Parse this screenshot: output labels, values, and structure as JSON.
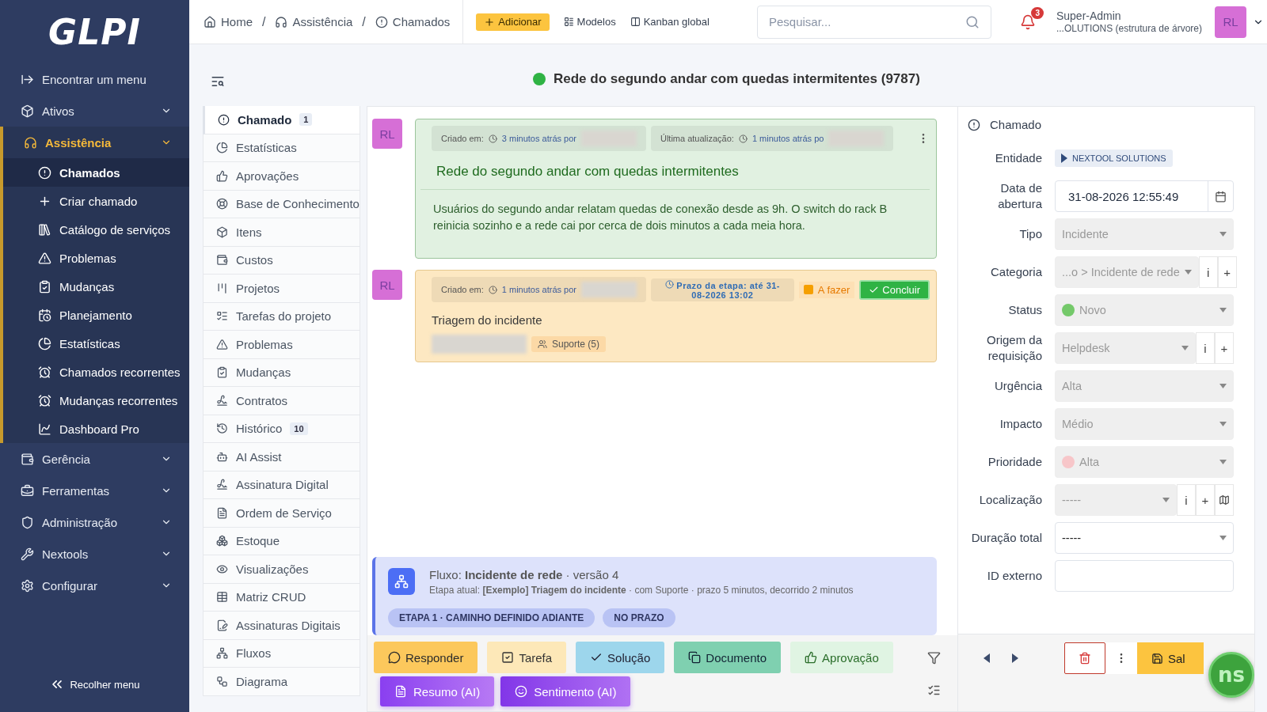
{
  "sidebar": {
    "logo": "GLPI",
    "find_menu": "Encontrar um menu",
    "items": [
      {
        "label": "Ativos",
        "expanded": false,
        "selected": false
      },
      {
        "label": "Assistência",
        "expanded": true,
        "selected": true,
        "children": [
          {
            "label": "Chamados",
            "selected": true
          },
          {
            "label": "Criar chamado",
            "selected": false
          },
          {
            "label": "Catálogo de serviços",
            "selected": false
          },
          {
            "label": "Problemas",
            "selected": false
          },
          {
            "label": "Mudanças",
            "selected": false
          },
          {
            "label": "Planejamento",
            "selected": false
          },
          {
            "label": "Estatísticas",
            "selected": false
          },
          {
            "label": "Chamados recorrentes",
            "selected": false
          },
          {
            "label": "Mudanças recorrentes",
            "selected": false
          },
          {
            "label": "Dashboard Pro",
            "selected": false
          }
        ]
      },
      {
        "label": "Gerência",
        "expanded": false,
        "selected": false
      },
      {
        "label": "Ferramentas",
        "expanded": false,
        "selected": false
      },
      {
        "label": "Administração",
        "expanded": false,
        "selected": false
      },
      {
        "label": "Nextools",
        "expanded": false,
        "selected": false
      },
      {
        "label": "Configurar",
        "expanded": false,
        "selected": false
      }
    ],
    "collapse": "Recolher menu"
  },
  "breadcrumb": {
    "items": [
      "Home",
      "Assistência",
      "Chamados"
    ],
    "separator": "/"
  },
  "toolbar": {
    "add": "Adicionar",
    "templates": "Modelos",
    "kanban": "Kanban global"
  },
  "search": {
    "placeholder": "Pesquisar..."
  },
  "notifications": {
    "count": "3"
  },
  "user": {
    "name": "Super-Admin",
    "entity": "...OLUTIONS (estrutura de árvore)",
    "initials": "RL"
  },
  "ticket_title": "Rede do segundo andar com quedas intermitentes (9787)",
  "tabs": [
    {
      "label": "Chamado",
      "count": "1",
      "selected": true
    },
    {
      "label": "Estatísticas",
      "selected": false
    },
    {
      "label": "Aprovações",
      "selected": false
    },
    {
      "label": "Base de Conhecimento",
      "selected": false
    },
    {
      "label": "Itens",
      "selected": false
    },
    {
      "label": "Custos",
      "selected": false
    },
    {
      "label": "Projetos",
      "selected": false
    },
    {
      "label": "Tarefas do projeto",
      "selected": false
    },
    {
      "label": "Problemas",
      "selected": false
    },
    {
      "label": "Mudanças",
      "selected": false
    },
    {
      "label": "Contratos",
      "selected": false
    },
    {
      "label": "Histórico",
      "count": "10",
      "selected": false
    },
    {
      "label": "AI Assist",
      "selected": false
    },
    {
      "label": "Assinatura Digital",
      "selected": false
    },
    {
      "label": "Ordem de Serviço",
      "selected": false
    },
    {
      "label": "Estoque",
      "selected": false
    },
    {
      "label": "Visualizações",
      "selected": false
    },
    {
      "label": "Matriz CRUD",
      "selected": false
    },
    {
      "label": "Assinaturas Digitais",
      "selected": false
    },
    {
      "label": "Fluxos",
      "selected": false
    },
    {
      "label": "Diagrama",
      "selected": false
    }
  ],
  "timeline": [
    {
      "kind": "followup",
      "initials": "RL",
      "created_label": "Criado em:",
      "created": "3 minutos atrás por",
      "updated_label": "Última atualização:",
      "updated": "1 minutos atrás po",
      "title": "Rede do segundo andar com quedas intermitentes",
      "body": "Usuários do segundo andar relatam quedas de conexão desde as 9h. O switch do rack B reinicia sozinho e a rede cai por cerca de dois minutos a cada meia hora."
    },
    {
      "kind": "task",
      "initials": "RL",
      "created_label": "Criado em:",
      "created": "1 minutos atrás por",
      "deadline": "Prazo da etapa: até 31-08-2026 13:02",
      "state": "A fazer",
      "action": "Concluir",
      "body": "Triagem do incidente",
      "group": "Suporte (5)"
    }
  ],
  "flow": {
    "title": "Fluxo: **Incidente de rede** · versão 4",
    "step": "Etapa atual: **[Exemplo] Triagem do incidente** · com Suporte · prazo 5 minutos, decorrido 2 minutos",
    "badges": [
      "ETAPA 1 · CAMINHO DEFINIDO ADIANTE",
      "NO PRAZO"
    ]
  },
  "actions": [
    {
      "label": "Responder",
      "kind": "followup"
    },
    {
      "label": "Tarefa",
      "kind": "task"
    },
    {
      "label": "Solução",
      "kind": "solution"
    },
    {
      "label": "Documento",
      "kind": "document"
    },
    {
      "label": "Aprovação",
      "kind": "approval"
    }
  ],
  "ai_actions": [
    {
      "label": "Resumo (AI)",
      "kind": "summary"
    },
    {
      "label": "Sentimento (AI)",
      "kind": "sentiment"
    }
  ],
  "form": {
    "title": "Chamado",
    "fields": [
      {
        "label": "Entidade",
        "kind": "entity",
        "value": "NEXTOOL SOLUTIONS"
      },
      {
        "label": "Data de abertura",
        "kind": "date",
        "value": "31-08-2026 12:55:49"
      },
      {
        "label": "Tipo",
        "kind": "select",
        "value": "Incidente",
        "disabled": true
      },
      {
        "label": "Categoria",
        "kind": "select",
        "value": "...o > Incidente de rede",
        "disabled": true,
        "extras": [
          "i",
          "+"
        ]
      },
      {
        "label": "Status",
        "kind": "select",
        "value": "Novo",
        "disabled": true,
        "color": "#74c96a"
      },
      {
        "label": "Origem da requisição",
        "kind": "select",
        "value": "Helpdesk",
        "disabled": true,
        "extras": [
          "i",
          "+"
        ]
      },
      {
        "label": "Urgência",
        "kind": "select",
        "value": "Alta",
        "disabled": true
      },
      {
        "label": "Impacto",
        "kind": "select",
        "value": "Médio",
        "disabled": true
      },
      {
        "label": "Prioridade",
        "kind": "select",
        "value": "Alta",
        "disabled": true,
        "color": "#f7c6c9"
      },
      {
        "label": "Localização",
        "kind": "select",
        "value": "-----",
        "disabled": true,
        "extras": [
          "i",
          "+"
        ],
        "map": true
      },
      {
        "label": "Duração total",
        "kind": "select",
        "value": "-----",
        "disabled": false
      },
      {
        "label": "ID externo",
        "kind": "input"
      }
    ]
  },
  "footer": {
    "save": "Sal",
    "assistant": "ns"
  }
}
